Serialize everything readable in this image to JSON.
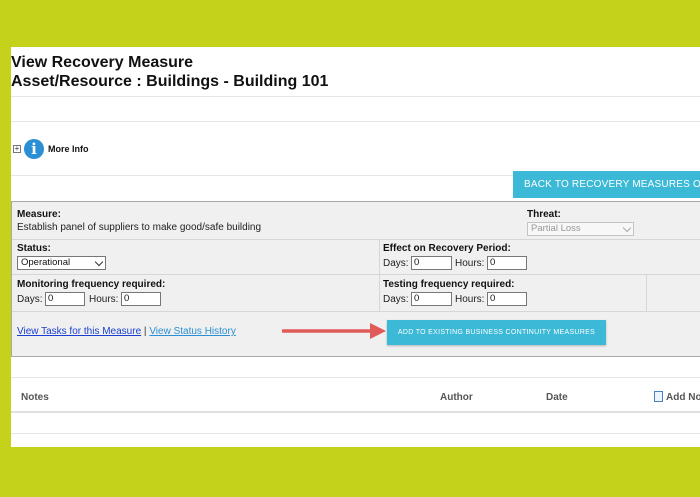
{
  "header": {
    "title_line1": "View Recovery Measure",
    "title_line2": "Asset/Resource : Buildings - Building 101"
  },
  "more_info": {
    "toggle": "+",
    "label": "More Info",
    "icon": "info-icon"
  },
  "back_button_label": "BACK TO RECOVERY MEASURES OVERVIEW",
  "form": {
    "measure_label": "Measure:",
    "measure_value": "Establish panel of suppliers to make good/safe building",
    "threat_label": "Threat:",
    "threat_value": "Partial Loss",
    "status_label": "Status:",
    "status_value": "Operational",
    "effect_label": "Effect on Recovery Period:",
    "effect_days_label": "Days:",
    "effect_days_value": "0",
    "effect_hours_label": "Hours:",
    "effect_hours_value": "0",
    "monitoring_label": "Monitoring frequency required:",
    "monitoring_days_label": "Days:",
    "monitoring_days_value": "0",
    "monitoring_hours_label": "Hours:",
    "monitoring_hours_value": "0",
    "testing_label": "Testing frequency required:",
    "testing_days_label": "Days:",
    "testing_days_value": "0",
    "testing_hours_label": "Hours:",
    "testing_hours_value": "0"
  },
  "links": {
    "view_tasks": "View Tasks for this Measure",
    "separator": "|",
    "view_status_history": "View Status History"
  },
  "add_button_label": "ADD TO EXISTING BUSINESS CONTINUITY MEASURES",
  "notes_table": {
    "columns": [
      "Notes",
      "Author",
      "Date"
    ],
    "add_label": "Add Note"
  },
  "colors": {
    "background": "#c4d21c",
    "button": "#3bb9d6",
    "arrow": "#e05a5a",
    "link": "#1a3fd0"
  }
}
